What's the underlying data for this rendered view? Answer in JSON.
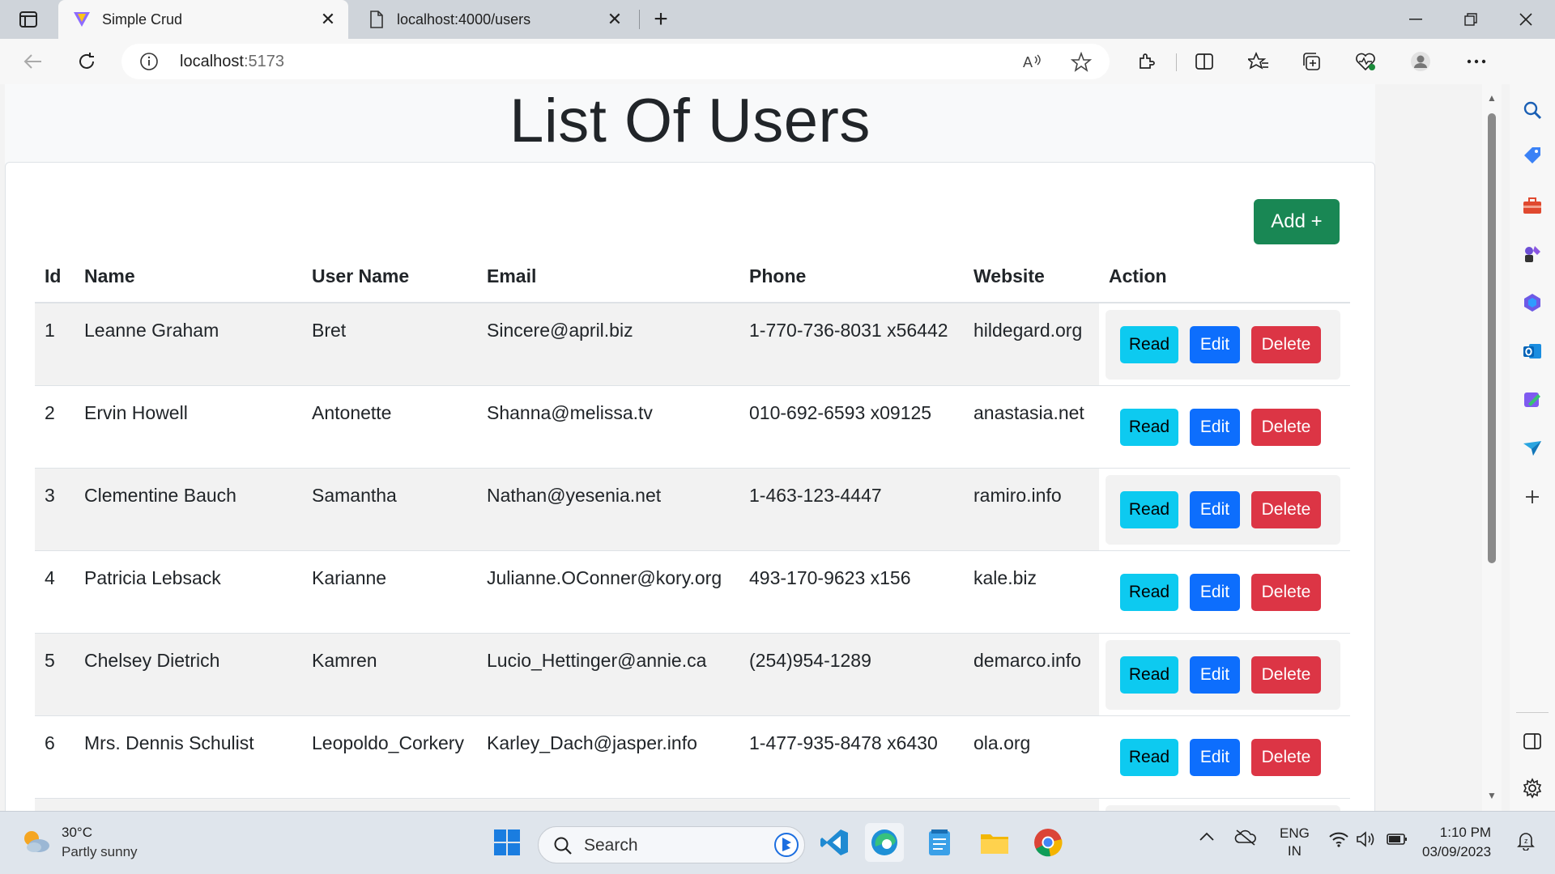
{
  "browser": {
    "tabs": [
      {
        "title": "Simple Crud",
        "active": true
      },
      {
        "title": "localhost:4000/users",
        "active": false
      }
    ],
    "address": {
      "host": "localhost",
      "port": ":5173"
    }
  },
  "page": {
    "title": "List Of Users",
    "add_button": "Add +",
    "columns": [
      "Id",
      "Name",
      "User Name",
      "Email",
      "Phone",
      "Website",
      "Action"
    ],
    "rows": [
      {
        "id": "1",
        "name": "Leanne Graham",
        "username": "Bret",
        "email": "Sincere@april.biz",
        "phone": "1-770-736-8031 x56442",
        "website": "hildegard.org"
      },
      {
        "id": "2",
        "name": "Ervin Howell",
        "username": "Antonette",
        "email": "Shanna@melissa.tv",
        "phone": "010-692-6593 x09125",
        "website": "anastasia.net"
      },
      {
        "id": "3",
        "name": "Clementine Bauch",
        "username": "Samantha",
        "email": "Nathan@yesenia.net",
        "phone": "1-463-123-4447",
        "website": "ramiro.info"
      },
      {
        "id": "4",
        "name": "Patricia Lebsack",
        "username": "Karianne",
        "email": "Julianne.OConner@kory.org",
        "phone": "493-170-9623 x156",
        "website": "kale.biz"
      },
      {
        "id": "5",
        "name": "Chelsey Dietrich",
        "username": "Kamren",
        "email": "Lucio_Hettinger@annie.ca",
        "phone": "(254)954-1289",
        "website": "demarco.info"
      },
      {
        "id": "6",
        "name": "Mrs. Dennis Schulist",
        "username": "Leopoldo_Corkery",
        "email": "Karley_Dach@jasper.info",
        "phone": "1-477-935-8478 x6430",
        "website": "ola.org"
      }
    ],
    "actions": {
      "read": "Read",
      "edit": "Edit",
      "delete": "Delete"
    },
    "colors": {
      "add": "#198754",
      "read": "#0dcaf0",
      "edit": "#0d6efd",
      "delete": "#dc3545"
    }
  },
  "taskbar": {
    "weather": {
      "temp": "30°C",
      "condition": "Partly sunny"
    },
    "search_label": "Search",
    "lang": {
      "line1": "ENG",
      "line2": "IN"
    },
    "clock": {
      "time": "1:10 PM",
      "date": "03/09/2023"
    }
  }
}
